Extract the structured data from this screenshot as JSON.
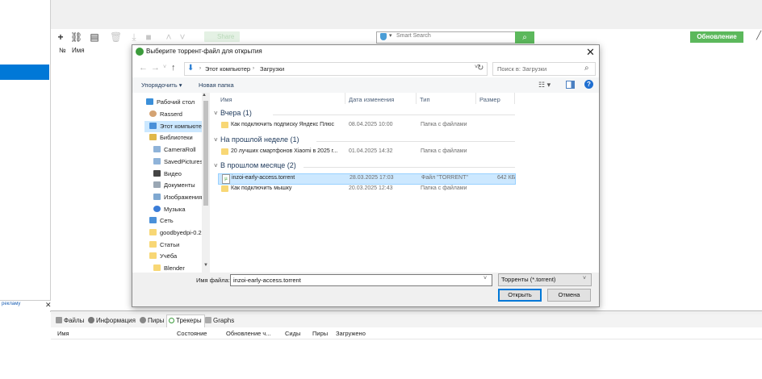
{
  "app": {
    "column_headers": {
      "num": "№",
      "name": "Имя"
    },
    "search_placeholder": "Smart Search",
    "share_label": "Share",
    "update_label": "Обновление",
    "ad_label": "рекламу",
    "bottom_tabs": [
      "Файлы",
      "Информация",
      "Пиры",
      "Трекеры",
      "Graphs"
    ],
    "bottom_columns": [
      "Имя",
      "Состояние",
      "Обновление ч...",
      "Сиды",
      "Пиры",
      "Загружено"
    ],
    "accent_color": "#5cb85c",
    "selection_color": "#0078d7"
  },
  "dialog": {
    "title": "Выберите торрент-файл для открытия",
    "breadcrumb": [
      "Этот компьютер",
      "Загрузки"
    ],
    "search_placeholder": "Поиск в: Загрузки",
    "organize_label": "Упорядочить ▾",
    "new_folder_label": "Новая папка",
    "nav_items": [
      {
        "label": "Рабочий стол",
        "icon": "desktop-icon"
      },
      {
        "label": "Rasserd",
        "icon": "user-icon"
      },
      {
        "label": "Этот компьютер",
        "icon": "computer-icon"
      },
      {
        "label": "Библиотеки",
        "icon": "library-icon"
      },
      {
        "label": "CameraRoll",
        "icon": "folder-icon"
      },
      {
        "label": "SavedPictures",
        "icon": "folder-icon"
      },
      {
        "label": "Видео",
        "icon": "video-icon"
      },
      {
        "label": "Документы",
        "icon": "documents-icon"
      },
      {
        "label": "Изображения",
        "icon": "pictures-icon"
      },
      {
        "label": "Музыка",
        "icon": "music-icon"
      },
      {
        "label": "Сеть",
        "icon": "network-icon"
      },
      {
        "label": "goodbyedpi-0.2.",
        "icon": "folder-icon"
      },
      {
        "label": "Статьи",
        "icon": "folder-icon"
      },
      {
        "label": "Учёба",
        "icon": "folder-icon"
      },
      {
        "label": "Blender",
        "icon": "folder-icon"
      }
    ],
    "file_columns": {
      "name": "Имя",
      "date": "Дата изменения",
      "type": "Тип",
      "size": "Размер"
    },
    "groups": [
      {
        "label": "Вчера (1)",
        "files": [
          {
            "name": "Как подключить подписку Яндекс Плюс",
            "date": "08.04.2025 10:00",
            "type": "Папка с файлами",
            "size": "",
            "icon": "folder-icon"
          }
        ]
      },
      {
        "label": "На прошлой неделе (1)",
        "files": [
          {
            "name": "20 лучших смартфонов Xiaomi в 2025 г...",
            "date": "01.04.2025 14:32",
            "type": "Папка с файлами",
            "size": "",
            "icon": "folder-icon"
          }
        ]
      },
      {
        "label": "В прошлом месяце (2)",
        "files": [
          {
            "name": "inzoi-early-access.torrent",
            "date": "28.03.2025 17:03",
            "type": "Файл \"TORRENT\"",
            "size": "642 КБ",
            "icon": "torrent-file-icon"
          },
          {
            "name": "Как подключить мышку",
            "date": "20.03.2025 12:43",
            "type": "Папка с файлами",
            "size": "",
            "icon": "folder-icon"
          }
        ]
      }
    ],
    "file_name_label": "Имя файла:",
    "file_name_value": "inzoi-early-access.torrent",
    "filter_value": "Торренты (*.torrent)",
    "open_label": "Открыть",
    "cancel_label": "Отмена"
  }
}
